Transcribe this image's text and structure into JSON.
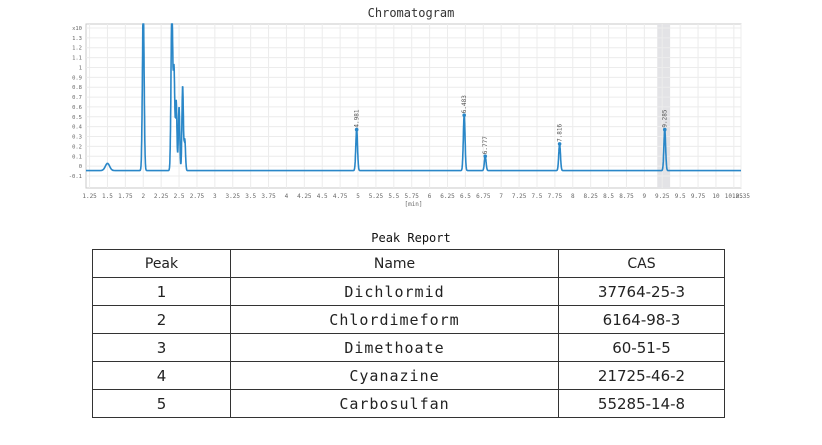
{
  "chart_data": {
    "type": "line",
    "title": "Chromatogram",
    "xlabel": "[min]",
    "ylabel": "x10^3",
    "xlim": [
      1.2,
      10.35
    ],
    "ylim": [
      -0.15,
      1.45
    ],
    "x_ticks": [
      "1.25",
      "1.5",
      "1.75",
      "2",
      "2.25",
      "2.5",
      "2.75",
      "3",
      "3.25",
      "3.5",
      "3.75",
      "4",
      "4.25",
      "4.5",
      "4.75",
      "5",
      "5.25",
      "5.5",
      "5.75",
      "6",
      "6.25",
      "6.5",
      "6.75",
      "7",
      "7.25",
      "7.5",
      "7.75",
      "8",
      "8.25",
      "8.5",
      "8.75",
      "9",
      "9.25",
      "9.5",
      "9.75",
      "10",
      "10.25",
      "10.35"
    ],
    "y_ticks": [
      "x10",
      "1.3",
      "1.2",
      "1.1",
      "1",
      "0.9",
      "0.8",
      "0.7",
      "0.6",
      "0.5",
      "0.4",
      "0.3",
      "0.2",
      "0.1",
      "0",
      "-0.1"
    ],
    "baseline": 0.02,
    "highlight_band": [
      9.18,
      9.36
    ],
    "background_peaks": [
      {
        "rt": 1.5,
        "height": 0.07,
        "width": 0.03
      },
      {
        "rt": 2.0,
        "height": 1.6,
        "width": 0.012
      },
      {
        "rt": 2.4,
        "height": 1.6,
        "width": 0.012
      },
      {
        "rt": 2.43,
        "height": 0.95,
        "width": 0.01
      },
      {
        "rt": 2.46,
        "height": 0.68,
        "width": 0.01
      },
      {
        "rt": 2.5,
        "height": 0.62,
        "width": 0.01
      },
      {
        "rt": 2.55,
        "height": 0.82,
        "width": 0.01
      },
      {
        "rt": 2.58,
        "height": 0.3,
        "width": 0.01
      }
    ],
    "series": [
      {
        "peak": 1,
        "rt": 4.981,
        "label": "4.981",
        "height": 0.4
      },
      {
        "peak": 2,
        "rt": 6.483,
        "label": "6.483",
        "height": 0.54
      },
      {
        "peak": 3,
        "rt": 6.777,
        "label": "6.777",
        "height": 0.14
      },
      {
        "peak": 4,
        "rt": 7.816,
        "label": "7.816",
        "height": 0.26
      },
      {
        "peak": 5,
        "rt": 9.285,
        "label": "9.285",
        "height": 0.4
      }
    ],
    "line_color": "#2a87c8",
    "grid": true
  },
  "report": {
    "title": "Peak Report",
    "headers": [
      "Peak",
      "Name",
      "CAS"
    ],
    "rows": [
      [
        "1",
        "Dichlormid",
        "37764-25-3"
      ],
      [
        "2",
        "Chlordimeform",
        "6164-98-3"
      ],
      [
        "3",
        "Dimethoate",
        "60-51-5"
      ],
      [
        "4",
        "Cyanazine",
        "21725-46-2"
      ],
      [
        "5",
        "Carbosulfan",
        "55285-14-8"
      ]
    ]
  }
}
